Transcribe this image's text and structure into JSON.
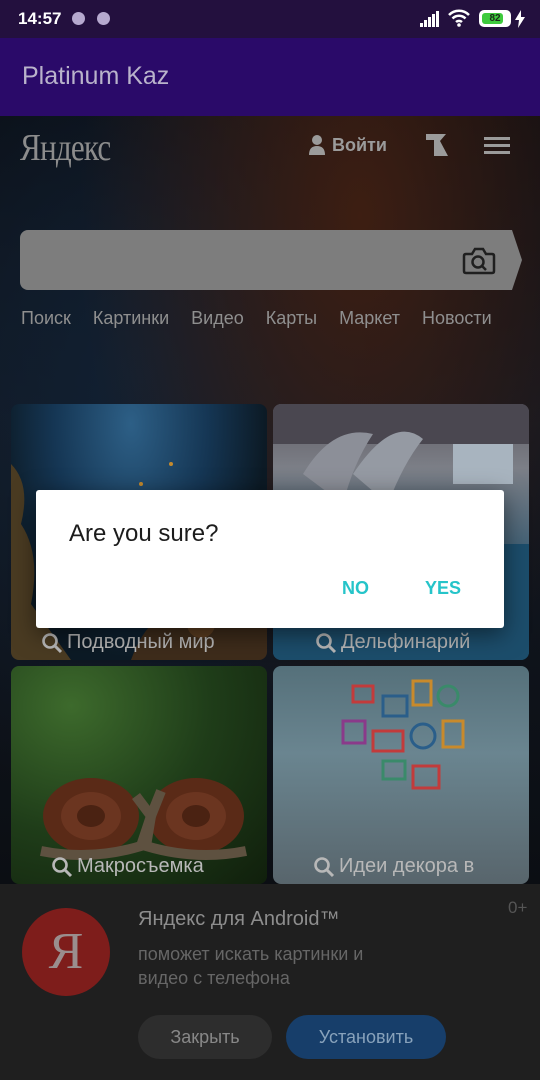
{
  "status_bar": {
    "time": "14:57",
    "battery": "82",
    "battery_level": 0.82,
    "accent_color": "#3eca3d"
  },
  "app_bar": {
    "title": "Platinum Kaz",
    "color": "#2a0a69"
  },
  "web": {
    "logo": "Яндекс",
    "login_label": "Войти",
    "nav_links": [
      "Поиск",
      "Картинки",
      "Видео",
      "Карты",
      "Маркет",
      "Новости"
    ],
    "tiles": [
      {
        "label": "Подводный мир"
      },
      {
        "label": "Дельфинарий"
      },
      {
        "label": "Макросъемка"
      },
      {
        "label": "Идеи декора в"
      }
    ]
  },
  "banner": {
    "logo_letter": "Я",
    "title": "Яндекс для Android™",
    "age": "0+",
    "description": "поможет искать картинки и видео с телефона",
    "close_label": "Закрыть",
    "install_label": "Установить"
  },
  "dialog": {
    "title": "Are you sure?",
    "no_label": "NO",
    "yes_label": "YES",
    "accent_color": "#26c4c9"
  }
}
